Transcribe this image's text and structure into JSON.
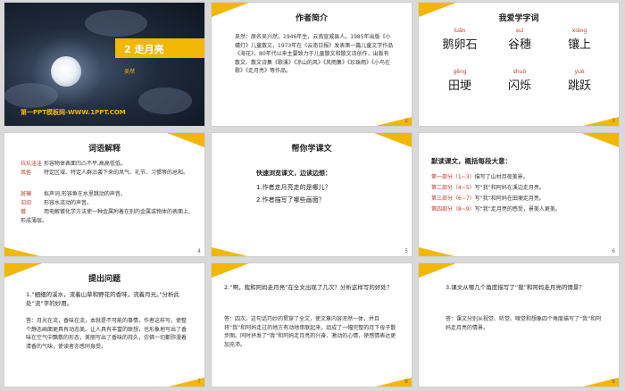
{
  "slides": [
    {
      "num": "",
      "title": "2 走月亮",
      "author": "吴然",
      "website": "第一PPT模板网-WWW.1PPT.COM"
    },
    {
      "num": "2",
      "title": "作者简介",
      "body": "吴然：原名吴兴然，1946年生，云南宣威县人。1985年出版《小蜻灯》儿童散文，1973年在《云南日报》发表第一篇儿童文学作品《海花》，80年代以来主要致力于儿童散文和散文诗创作，出版有散文、散文诗集《歌溪》《凉山的风》《风雨集》《珍珠雨》《小鸟在歌》《走月亮》等作品。"
    },
    {
      "num": "3",
      "title": "我爱学字词",
      "words": [
        {
          "py": "luǎn",
          "w": "鹅卵石"
        },
        {
          "py": "suì",
          "w": "谷穗"
        },
        {
          "py": "xiāng",
          "w": "镶上"
        },
        {
          "py": "gěng",
          "w": "田埂"
        },
        {
          "py": "shuò",
          "w": "闪烁"
        },
        {
          "py": "yuè",
          "w": "跳跃"
        }
      ]
    },
    {
      "num": "4",
      "title": "词语解释",
      "terms": [
        {
          "term": "坑坑洼洼",
          "def": "形容物体表面凹凸不平,高高低低。"
        },
        {
          "term": "风俗",
          "def": "特定区域、特定人群沿袭下来的风气、礼节、习惯等的总和。"
        },
        {
          "term": "",
          "def": ""
        },
        {
          "term": "斑斓",
          "def": "拟声词,形容鱼在水里跳动的声音。"
        },
        {
          "term": "汩汩",
          "def": "形容水流动的声音。"
        },
        {
          "term": "镀",
          "def": "用电解镀化学方法使一种金属附着在别的金属或物体的表面上,形成薄层。"
        }
      ]
    },
    {
      "num": "5",
      "title": "帮你学课文",
      "heading": "快速浏览课文，边读边想：",
      "q1": "1.作者走月亮走的是哪儿？",
      "q2": "2.作者描写了哪些画面？"
    },
    {
      "num": "6",
      "title": "默读课文，概括每段大意：",
      "parts": [
        {
          "label": "第一部分（1~3）",
          "text": "描写了山村月夜美景。"
        },
        {
          "label": "第二部分（4~5）",
          "text": "写“我”和阿妈在溪边走月亮。"
        },
        {
          "label": "第三部分（6~7）",
          "text": "写“我”和阿妈在田埂走月亮。"
        },
        {
          "label": "第四部分（8~9）",
          "text": "写“我”走月亮的感受，景美人更美。"
        }
      ]
    },
    {
      "num": "7",
      "title": "提出问题",
      "q": "1.“细细的溪水，流着山草和野花的香味，流着月光。”分析此处“流”字的妙用。",
      "a": "答：月光在流，香味在流，本就是不可能的事情，作者这样写，使整个静态画面更具有动态美。让人具有丰富的联想，也形象地写出了香味在空气中飘散的形态，美丽写出了香味的持久，仿佛一切都弥漫着清香的气味，使读者亦感同身受。"
    },
    {
      "num": "8",
      "q": "2.“啊，我和阿妈走月亮”在全文出现了几次？分析这样写的好处？",
      "a": "答：四次。这句话巧妙的贯穿了全文，使文章内容浑然一体，并且将“我”和阿妈走过的地方有动地串联起来，组成了一幅完整的月下母子散步图。同时抒发了“我”和阿妈走月亮的兴奋、激动的心情，使感情表达更加充沛。"
    },
    {
      "num": "9",
      "q": "3.课文从哪几个角度描写了“我”和阿妈走月亮的情景？",
      "a": "答：课文分别从视觉、听觉、嗅觉和想象四个角度描写了“我”和阿妈走月亮的情景。"
    }
  ],
  "colors": {
    "accent": "#f2b705",
    "red": "#c0392b"
  }
}
